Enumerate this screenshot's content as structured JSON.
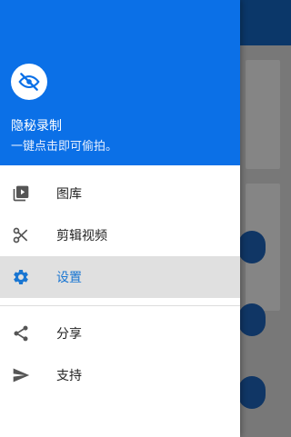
{
  "colors": {
    "accent": "#0b70e7",
    "active_text": "#1976d2",
    "icon": "#555555",
    "active_bg": "#e0e0e0"
  },
  "drawer": {
    "avatar_icon": "eye-off-icon",
    "title": "隐秘录制",
    "subtitle": "一键点击即可偷拍。",
    "items": [
      {
        "label": "图库",
        "icon": "video-library-icon",
        "active": false
      },
      {
        "label": "剪辑视频",
        "icon": "scissors-icon",
        "active": false
      },
      {
        "label": "设置",
        "icon": "gear-icon",
        "active": true
      }
    ],
    "secondary_items": [
      {
        "label": "分享",
        "icon": "share-icon"
      },
      {
        "label": "支持",
        "icon": "send-icon"
      }
    ]
  }
}
